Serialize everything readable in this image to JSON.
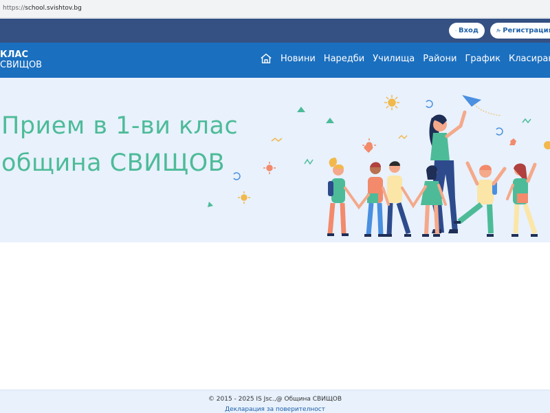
{
  "browser": {
    "url_protocol": "https://",
    "url_host": "school.svishtov.bg"
  },
  "topbar": {
    "login_label": "Вход",
    "register_label": "Регистрация"
  },
  "navbar": {
    "brand_line1": "КЛАС",
    "brand_line2": "СВИЩОВ",
    "items": [
      {
        "label": "Новини"
      },
      {
        "label": "Наредби"
      },
      {
        "label": "Училища"
      },
      {
        "label": "Райони"
      },
      {
        "label": "График"
      },
      {
        "label": "Класирания"
      }
    ]
  },
  "hero": {
    "title_line1": "Прием в 1-ви клас",
    "title_line2": "община СВИЩОВ"
  },
  "footer": {
    "copyright": "© 2015 - 2025 IS Jsc.,@ Община СВИЩОВ",
    "privacy_link": "Декларация за поверителност"
  },
  "colors": {
    "topbar_bg": "#355184",
    "navbar_bg": "#1b6fbf",
    "hero_bg": "#e8f1fc",
    "hero_text": "#4dbb98",
    "link": "#1d5fa8"
  }
}
